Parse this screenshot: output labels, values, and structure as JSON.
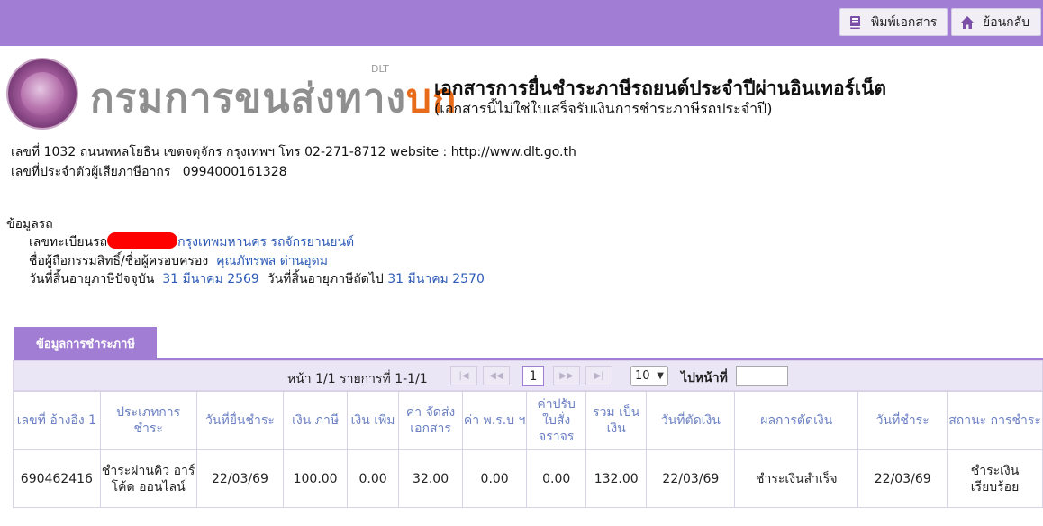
{
  "toolbar": {
    "print_label": "พิมพ์เอกสาร",
    "back_label": "ย้อนกลับ"
  },
  "logo": {
    "dlt_label": "DLT",
    "org_name_a": "กรมการขนส่งทาง",
    "org_name_b": "บก"
  },
  "document": {
    "title": "เอกสารการยื่นชำระภาษีรถยนต์ประจำปีผ่านอินเทอร์เน็ต",
    "subtitle": "(เอกสารนี้ไม่ใช่ใบเสร็จรับเงินการชำระภาษีรถประจำปี)",
    "address": "เลขที่ 1032 ถนนพหลโยธิน เขตจตุจักร กรุงเทพฯ โทร 02-271-8712 website : http://www.dlt.go.th",
    "taxid_label": "เลขที่ประจำตัวผู้เสียภาษีอากร",
    "taxid_value": "0994000161328"
  },
  "vehicle": {
    "section_title": "ข้อมูลรถ",
    "plate_label": "เลขทะเบียนรถ",
    "plate_province": "กรุงเทพมหานคร รถจักรยานยนต์",
    "owner_label": "ชื่อผู้ถือกรรมสิทธิ์/ชื่อผู้ครอบครอง",
    "owner_value": "คุณภัทรพล ด่านอุดม",
    "expire_label": "วันที่สิ้นอายุภาษีปัจจุบัน",
    "expire_value": "31 มีนาคม 2569",
    "next_label": "วันที่สิ้นอายุภาษีถัดไป",
    "next_value": "31 มีนาคม 2570"
  },
  "payment": {
    "tab_label": "ข้อมูลการชำระภาษี",
    "pager": {
      "summary": "หน้า 1/1 รายการที่ 1-1/1",
      "current_page": "1",
      "page_size": "10",
      "goto_label": "ไปหน้าที่",
      "goto_value": ""
    },
    "columns": [
      "เลขที่ อ้างอิง 1",
      "ประเภทการ ชำระ",
      "วันที่ยื่นชำระ",
      "เงิน ภาษี",
      "เงิน เพิ่ม",
      "ค่า จัดส่ง เอกสาร",
      "ค่า พ.ร.บ ฯ",
      "ค่าปรับ ใบสั่ง จราจร",
      "รวม เป็นเงิน",
      "วันที่ตัดเงิน",
      "ผลการตัดเงิน",
      "วันที่ชำระ",
      "สถานะ การชำระ"
    ],
    "rows": [
      [
        "690462416",
        "ชำระผ่านคิว อาร์โค้ด ออนไลน์",
        "22/03/69",
        "100.00",
        "0.00",
        "32.00",
        "0.00",
        "0.00",
        "132.00",
        "22/03/69",
        "ชำระเงินสำเร็จ",
        "22/03/69",
        "ชำระเงิน เรียบร้อย"
      ]
    ]
  },
  "colors": {
    "accent": "#a17ed4",
    "link": "#2d5ab7",
    "header_text": "#6a7fc3"
  }
}
